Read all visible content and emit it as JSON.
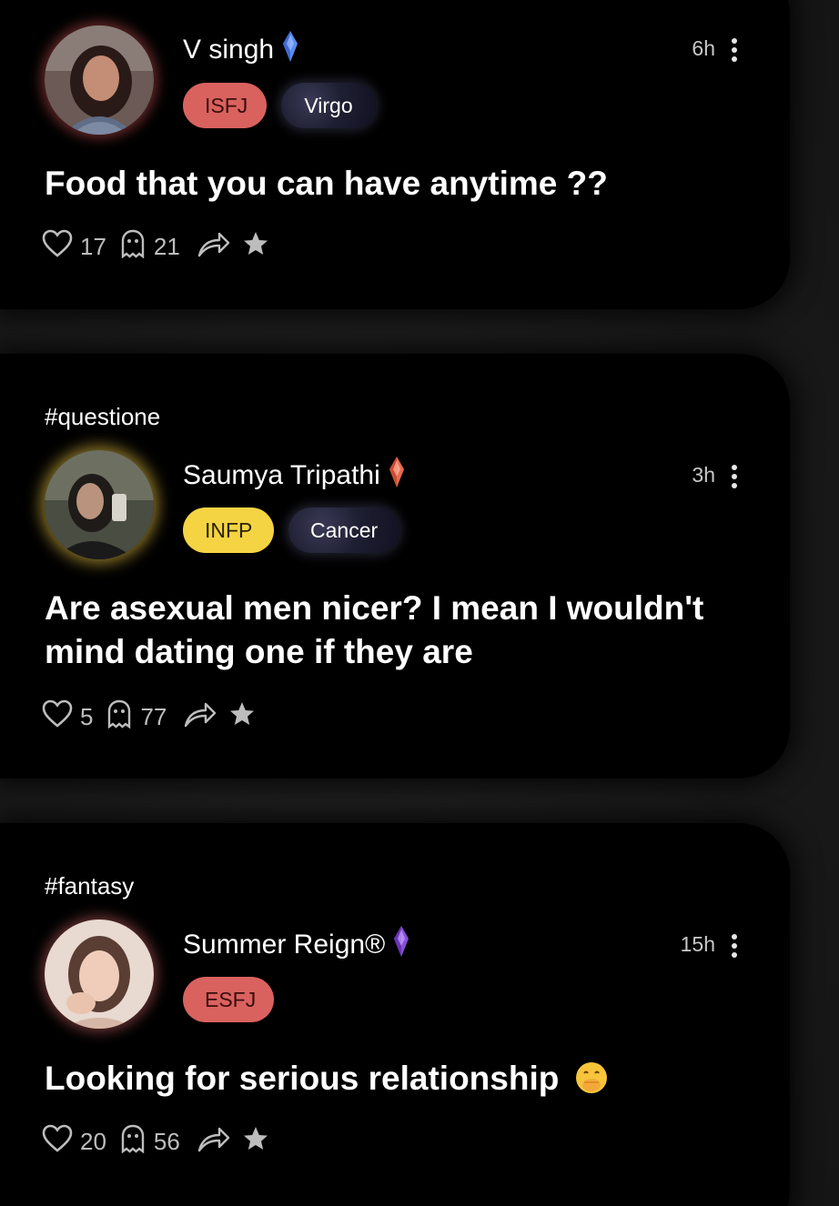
{
  "posts": [
    {
      "hashtag": "",
      "author": "V singh",
      "crystal_color": "#5b8cf0",
      "time": "6h",
      "mbti": "ISFJ",
      "zodiac": "Virgo",
      "text": "Food that you can have anytime ??",
      "likes": "17",
      "comments": "21"
    },
    {
      "hashtag": "#questione",
      "author": "Saumya Tripathi",
      "crystal_color": "#e86a4e",
      "time": "3h",
      "mbti": "INFP",
      "zodiac": "Cancer",
      "text": "Are asexual men nicer? I mean I wouldn't mind dating one if they are",
      "likes": "5",
      "comments": "77"
    },
    {
      "hashtag": "#fantasy",
      "author": "Summer Reign®",
      "crystal_color": "#8a4fd8",
      "time": "15h",
      "mbti": "ESFJ",
      "zodiac": "",
      "text": "Looking for serious relationship",
      "likes": "20",
      "comments": "56"
    }
  ],
  "colors": {
    "isfj_chip": "#d9625f",
    "infp_chip": "#f5d443",
    "esfj_chip": "#d9625f",
    "card_bg": "#000000"
  },
  "icons": [
    "heart-icon",
    "ghost-comment-icon",
    "share-arrow-icon",
    "star-icon",
    "more-vertical-icon",
    "crystal-icon",
    "hand-over-mouth-emoji"
  ]
}
